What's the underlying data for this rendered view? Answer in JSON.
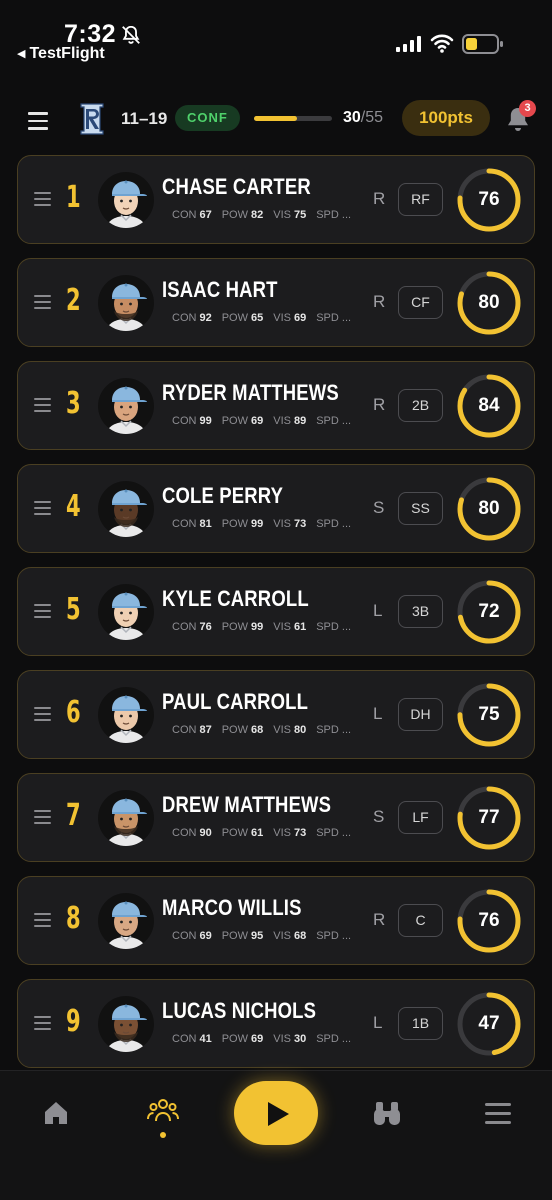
{
  "status_bar": {
    "time": "7:32",
    "back_label": "TestFlight",
    "icons": [
      "bell-slash-icon",
      "signal-icon",
      "wifi-icon",
      "battery-low-icon"
    ]
  },
  "header": {
    "record": "11–19",
    "conference_badge": "CONF",
    "progress": {
      "current": "30",
      "total": "/55",
      "fraction": 0.545
    },
    "points": "100pts",
    "notification_count": "3"
  },
  "colors": {
    "accent": "#f2c232",
    "background": "#0d0d0e",
    "card": "#1c1c1e",
    "conf_text": "#4fd16b",
    "badge": "#e5484d"
  },
  "stat_labels": {
    "con": "CON",
    "pow": "POW",
    "vis": "VIS",
    "spd": "SPD ..."
  },
  "lineup": [
    {
      "order": "1",
      "name": "CHASE CARTER",
      "con": "67",
      "pow": "82",
      "vis": "75",
      "hand": "R",
      "pos": "RF",
      "rating": "76",
      "skin": "#f1d3b8",
      "beard": false
    },
    {
      "order": "2",
      "name": "ISAAC HART",
      "con": "92",
      "pow": "65",
      "vis": "69",
      "hand": "R",
      "pos": "CF",
      "rating": "80",
      "skin": "#c68d63",
      "beard": true
    },
    {
      "order": "3",
      "name": "RYDER MATTHEWS",
      "con": "99",
      "pow": "69",
      "vis": "89",
      "hand": "R",
      "pos": "2B",
      "rating": "84",
      "skin": "#d9a47e",
      "beard": false
    },
    {
      "order": "4",
      "name": "COLE PERRY",
      "con": "81",
      "pow": "99",
      "vis": "73",
      "hand": "S",
      "pos": "SS",
      "rating": "80",
      "skin": "#5a3a26",
      "beard": true
    },
    {
      "order": "5",
      "name": "KYLE CARROLL",
      "con": "76",
      "pow": "99",
      "vis": "61",
      "hand": "L",
      "pos": "3B",
      "rating": "72",
      "skin": "#efd0b3",
      "beard": false
    },
    {
      "order": "6",
      "name": "PAUL CARROLL",
      "con": "87",
      "pow": "68",
      "vis": "80",
      "hand": "L",
      "pos": "DH",
      "rating": "75",
      "skin": "#ecc9aa",
      "beard": false
    },
    {
      "order": "7",
      "name": "DREW MATTHEWS",
      "con": "90",
      "pow": "61",
      "vis": "73",
      "hand": "S",
      "pos": "LF",
      "rating": "77",
      "skin": "#c99468",
      "beard": true
    },
    {
      "order": "8",
      "name": "MARCO WILLIS",
      "con": "69",
      "pow": "95",
      "vis": "68",
      "hand": "R",
      "pos": "C",
      "rating": "76",
      "skin": "#d8a884",
      "beard": false
    },
    {
      "order": "9",
      "name": "LUCAS NICHOLS",
      "con": "41",
      "pow": "69",
      "vis": "30",
      "hand": "L",
      "pos": "1B",
      "rating": "47",
      "skin": "#7a5034",
      "beard": true
    }
  ],
  "bottom_nav": {
    "items": [
      "home-icon",
      "team-icon",
      "play-icon",
      "scouting-icon",
      "menu-icon"
    ],
    "active": "team-icon"
  }
}
